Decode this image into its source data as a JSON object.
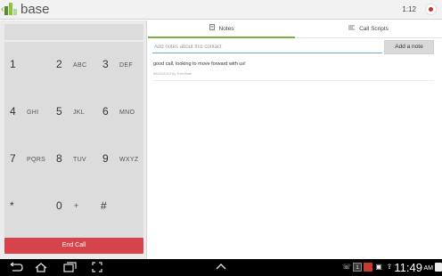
{
  "app": {
    "title": "base",
    "time": "1:12",
    "icons": {
      "back": "chevron-left-icon",
      "logo": "base-logo",
      "record": "record-icon"
    },
    "colors": {
      "accent": "#78b142",
      "end_call": "#d7434a",
      "record": "#d42b2b"
    }
  },
  "dialer": {
    "keys": [
      {
        "digit": "1",
        "letters": ""
      },
      {
        "digit": "2",
        "letters": "ABC"
      },
      {
        "digit": "3",
        "letters": "DEF"
      },
      {
        "digit": "4",
        "letters": "GHI"
      },
      {
        "digit": "5",
        "letters": "JKL"
      },
      {
        "digit": "6",
        "letters": "MNO"
      },
      {
        "digit": "7",
        "letters": "PQRS"
      },
      {
        "digit": "8",
        "letters": "TUV"
      },
      {
        "digit": "9",
        "letters": "WXYZ"
      },
      {
        "digit": "*",
        "letters": ""
      },
      {
        "digit": "0",
        "letters": "+"
      },
      {
        "digit": "#",
        "letters": ""
      }
    ],
    "end_call_label": "End Call"
  },
  "tabs": [
    {
      "label": "Notes",
      "icon": "document-icon",
      "active": true
    },
    {
      "label": "Call Scripts",
      "icon": "list-icon",
      "active": false
    }
  ],
  "notes": {
    "input_value": "",
    "input_placeholder": "Add notes about this contact",
    "add_button_label": "Add a note",
    "items": [
      {
        "text": "good call, looking to move forward with us!",
        "meta": "06/21/2013 by Tom Burk"
      }
    ]
  },
  "system": {
    "time": "11:49",
    "ampm": "AM",
    "nav_icons": [
      "back-icon",
      "home-icon",
      "recent-apps-icon",
      "screenshot-icon",
      "up-arrow-icon"
    ],
    "status_icons": [
      "phone-icon",
      "notification-icon",
      "media-icon",
      "image-icon",
      "upload-icon",
      "wifi-icon",
      "battery-icon"
    ]
  }
}
